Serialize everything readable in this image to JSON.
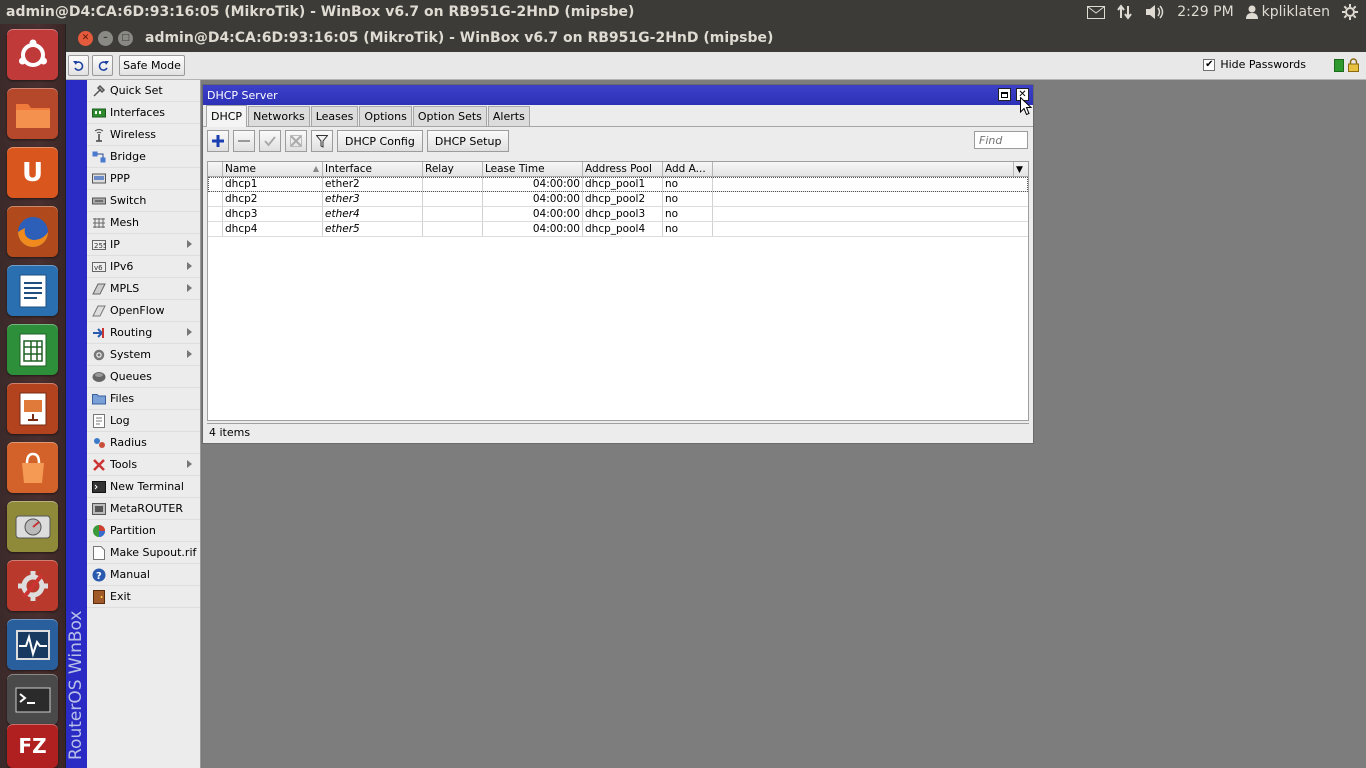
{
  "top_panel": {
    "title": "admin@D4:CA:6D:93:16:05 (MikroTik) - WinBox v6.7 on RB951G-2HnD (mipsbe)",
    "time": "2:29 PM",
    "user": "kpliklaten"
  },
  "launcher": {
    "items": [
      "ubuntu-home",
      "files",
      "ubuntu-one",
      "firefox",
      "writer",
      "calc",
      "impress",
      "software-center",
      "disk-utility",
      "system-settings",
      "system-monitor",
      "terminal",
      "filezilla"
    ]
  },
  "app_window": {
    "title": "admin@D4:CA:6D:93:16:05 (MikroTik) - WinBox v6.7 on RB951G-2HnD (mipsbe)"
  },
  "toolbar": {
    "safe_mode_label": "Safe Mode",
    "hide_passwords_label": "Hide Passwords",
    "hide_passwords_checked": "✔"
  },
  "sidebar": {
    "vertical_label": "RouterOS WinBox",
    "items": [
      {
        "label": "Quick Set",
        "submenu": false
      },
      {
        "label": "Interfaces",
        "submenu": false
      },
      {
        "label": "Wireless",
        "submenu": false
      },
      {
        "label": "Bridge",
        "submenu": false
      },
      {
        "label": "PPP",
        "submenu": false
      },
      {
        "label": "Switch",
        "submenu": false
      },
      {
        "label": "Mesh",
        "submenu": false
      },
      {
        "label": "IP",
        "submenu": true
      },
      {
        "label": "IPv6",
        "submenu": true
      },
      {
        "label": "MPLS",
        "submenu": true
      },
      {
        "label": "OpenFlow",
        "submenu": false
      },
      {
        "label": "Routing",
        "submenu": true
      },
      {
        "label": "System",
        "submenu": true
      },
      {
        "label": "Queues",
        "submenu": false
      },
      {
        "label": "Files",
        "submenu": false
      },
      {
        "label": "Log",
        "submenu": false
      },
      {
        "label": "Radius",
        "submenu": false
      },
      {
        "label": "Tools",
        "submenu": true
      },
      {
        "label": "New Terminal",
        "submenu": false
      },
      {
        "label": "MetaROUTER",
        "submenu": false
      },
      {
        "label": "Partition",
        "submenu": false
      },
      {
        "label": "Make Supout.rif",
        "submenu": false
      },
      {
        "label": "Manual",
        "submenu": false
      },
      {
        "label": "Exit",
        "submenu": false
      }
    ]
  },
  "dhcp_window": {
    "title": "DHCP Server",
    "tabs": [
      "DHCP",
      "Networks",
      "Leases",
      "Options",
      "Option Sets",
      "Alerts"
    ],
    "active_tab": "DHCP",
    "buttons": {
      "dhcp_config": "DHCP Config",
      "dhcp_setup": "DHCP Setup"
    },
    "find_placeholder": "Find",
    "columns": [
      "Name",
      "Interface",
      "Relay",
      "Lease Time",
      "Address Pool",
      "Add A..."
    ],
    "rows": [
      {
        "name": "dhcp1",
        "interface": "ether2",
        "relay": "",
        "lease_time": "04:00:00",
        "pool": "dhcp_pool1",
        "add_arp": "no"
      },
      {
        "name": "dhcp2",
        "interface": "ether3",
        "relay": "",
        "lease_time": "04:00:00",
        "pool": "dhcp_pool2",
        "add_arp": "no"
      },
      {
        "name": "dhcp3",
        "interface": "ether4",
        "relay": "",
        "lease_time": "04:00:00",
        "pool": "dhcp_pool3",
        "add_arp": "no"
      },
      {
        "name": "dhcp4",
        "interface": "ether5",
        "relay": "",
        "lease_time": "04:00:00",
        "pool": "dhcp_pool4",
        "add_arp": "no"
      }
    ],
    "status": "4 items"
  },
  "colors": {
    "panel": "#3c3b37",
    "title_blue": "#2d31b8",
    "sidebar_blue": "#2a2ac4",
    "workspace": "#7d7d7d"
  }
}
